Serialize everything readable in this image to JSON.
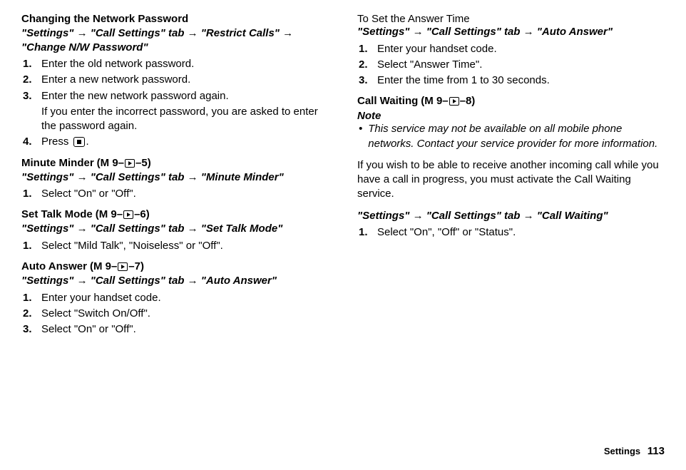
{
  "left": {
    "s1": {
      "title": "Changing the Network Password",
      "path": "\"Settings\" → \"Call Settings\" tab → \"Restrict Calls\" → \"Change N/W Password\"",
      "steps": [
        {
          "n": "1.",
          "t": "Enter the old network password."
        },
        {
          "n": "2.",
          "t": "Enter a new network password."
        },
        {
          "n": "3.",
          "t": "Enter the new network password again."
        }
      ],
      "sub": "If you enter the incorrect password, you are asked to enter the password again.",
      "step4n": "4.",
      "step4a": "Press ",
      "step4b": "."
    },
    "s2": {
      "title": "Minute Minder",
      "code_a": " (M 9–",
      "code_b": "–5)",
      "path": "\"Settings\" → \"Call Settings\" tab → \"Minute Minder\"",
      "step": {
        "n": "1.",
        "t": "Select \"On\" or \"Off\"."
      }
    },
    "s3": {
      "title": "Set Talk Mode",
      "code_a": " (M 9–",
      "code_b": "–6)",
      "path": "\"Settings\" → \"Call Settings\" tab → \"Set Talk Mode\"",
      "step": {
        "n": "1.",
        "t": "Select \"Mild Talk\", \"Noiseless\" or \"Off\"."
      }
    },
    "s4": {
      "title": "Auto Answer",
      "code_a": " (M 9–",
      "code_b": "–7)",
      "path": "\"Settings\" → \"Call Settings\" tab → \"Auto Answer\"",
      "steps": [
        {
          "n": "1.",
          "t": "Enter your handset code."
        },
        {
          "n": "2.",
          "t": "Select \"Switch On/Off\"."
        },
        {
          "n": "3.",
          "t": "Select \"On\" or \"Off\"."
        }
      ]
    }
  },
  "right": {
    "s1": {
      "title": "To Set the Answer Time",
      "path": "\"Settings\" → \"Call Settings\" tab → \"Auto Answer\"",
      "steps": [
        {
          "n": "1.",
          "t": "Enter your handset code."
        },
        {
          "n": "2.",
          "t": "Select \"Answer Time\"."
        },
        {
          "n": "3.",
          "t": "Enter the time from 1 to 30 seconds."
        }
      ]
    },
    "s2": {
      "title": "Call Waiting",
      "code_a": " (M 9–",
      "code_b": "–8)",
      "note_label": "Note",
      "note_text": "This service may not be available on all mobile phone networks. Contact your service provider for more information.",
      "para": "If you wish to be able to receive another incoming call while you have a call in progress, you must activate the Call Waiting service.",
      "path": "\"Settings\" → \"Call Settings\" tab → \"Call Waiting\"",
      "step": {
        "n": "1.",
        "t": "Select \"On\", \"Off\" or \"Status\"."
      }
    }
  },
  "footer": {
    "label": "Settings",
    "page": "113"
  }
}
